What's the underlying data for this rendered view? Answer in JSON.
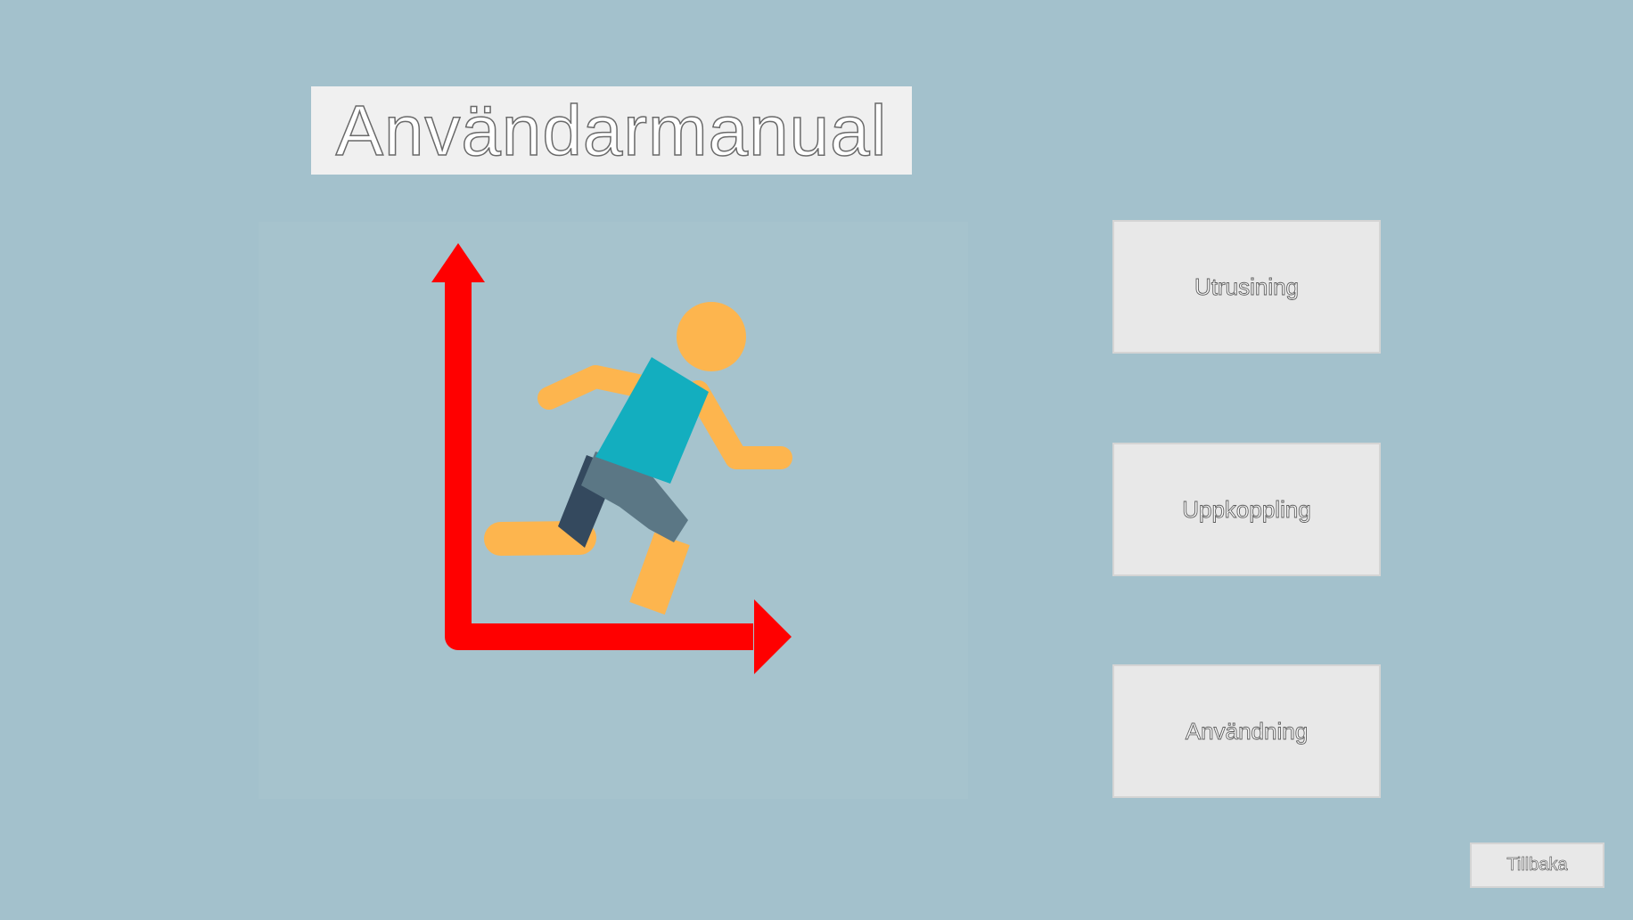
{
  "header": {
    "title": "Användarmanual"
  },
  "illustration": {
    "icon": "running-person-with-axes-icon",
    "colors": {
      "arrows": "#ff0000",
      "skin": "#fdb54e",
      "shirt": "#13aebf",
      "shorts": "#5b7785",
      "shorts_dark": "#34495e"
    }
  },
  "menu": {
    "buttons": [
      {
        "label": "Utrusining"
      },
      {
        "label": "Uppkoppling"
      },
      {
        "label": "Användning"
      }
    ]
  },
  "footer": {
    "back_label": "Tillbaka"
  }
}
